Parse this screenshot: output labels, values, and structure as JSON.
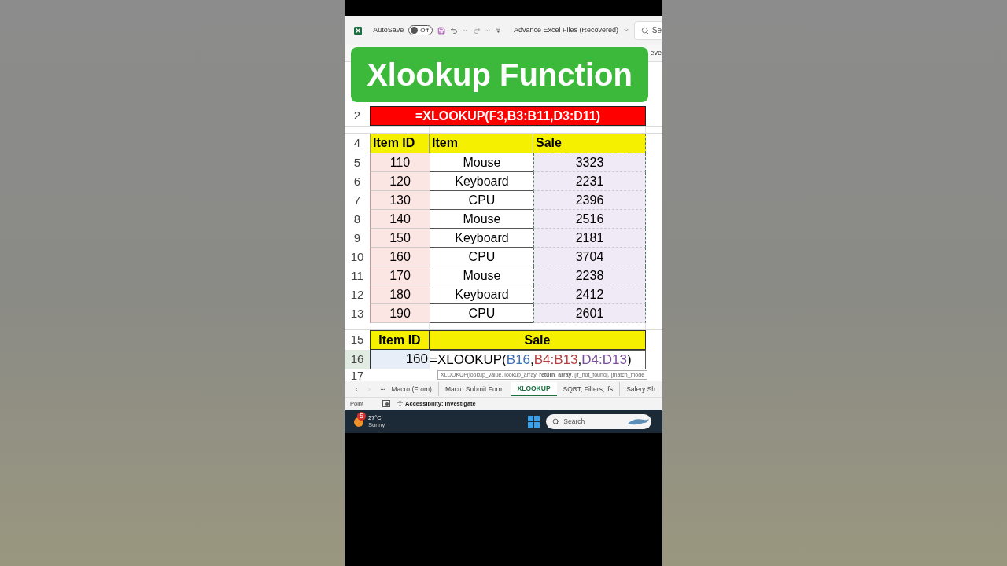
{
  "title_bar": {
    "autosave_label": "AutoSave",
    "autosave_toggle": {
      "label": "Off",
      "on": false
    },
    "file_name": "Advance Excel Files (Recovered)",
    "search_placeholder": "Se"
  },
  "ribbon_fragment": "eve",
  "banner": "Xlookup Function",
  "formula_row": {
    "row": "2",
    "text": "=XLOOKUP(F3,B3:B11,D3:D11)"
  },
  "table": {
    "header_row": "4",
    "columns": [
      "Item ID",
      "Item",
      "Sale"
    ],
    "rows": [
      {
        "row": "5",
        "cells": [
          "110",
          "Mouse",
          "3323"
        ]
      },
      {
        "row": "6",
        "cells": [
          "120",
          "Keyboard",
          "2231"
        ]
      },
      {
        "row": "7",
        "cells": [
          "130",
          "CPU",
          "2396"
        ]
      },
      {
        "row": "8",
        "cells": [
          "140",
          "Mouse",
          "2516"
        ]
      },
      {
        "row": "9",
        "cells": [
          "150",
          "Keyboard",
          "2181"
        ]
      },
      {
        "row": "10",
        "cells": [
          "160",
          "CPU",
          "3704"
        ]
      },
      {
        "row": "11",
        "cells": [
          "170",
          "Mouse",
          "2238"
        ]
      },
      {
        "row": "12",
        "cells": [
          "180",
          "Keyboard",
          "2412"
        ]
      },
      {
        "row": "13",
        "cells": [
          "190",
          "CPU",
          "2601"
        ]
      }
    ]
  },
  "lookup": {
    "header_row": "15",
    "columns": [
      "Item ID",
      "Sale"
    ],
    "row": "16",
    "value": "160",
    "formula_parts": [
      {
        "text": "=XLOOKUP("
      },
      {
        "text": "B16",
        "color": "#3b6fb6"
      },
      {
        "text": ","
      },
      {
        "text": "B4:B13",
        "color": "#b3403f"
      },
      {
        "text": ","
      },
      {
        "text": "D4:D13",
        "color": "#7a4e9a"
      },
      {
        "text": ")"
      }
    ],
    "row_after": "17",
    "tooltip": "XLOOKUP(lookup_value, lookup_array, **return_array**, [if_not_found], [match_mode"
  },
  "sheet_tabs": [
    {
      "label": "Macro (From)",
      "selected": false
    },
    {
      "label": "Macro Submit Form",
      "selected": false
    },
    {
      "label": "XLOOKUP",
      "selected": true
    },
    {
      "label": "SQRT, Filters, ifs",
      "selected": false
    },
    {
      "label": "Salery Sh",
      "selected": false
    }
  ],
  "status_bar": {
    "mode": "Point",
    "accessibility": "Accessibility: Investigate"
  },
  "taskbar": {
    "temperature": "27°C",
    "condition": "Sunny",
    "weather_badge": "5",
    "search_placeholder": "Search"
  }
}
